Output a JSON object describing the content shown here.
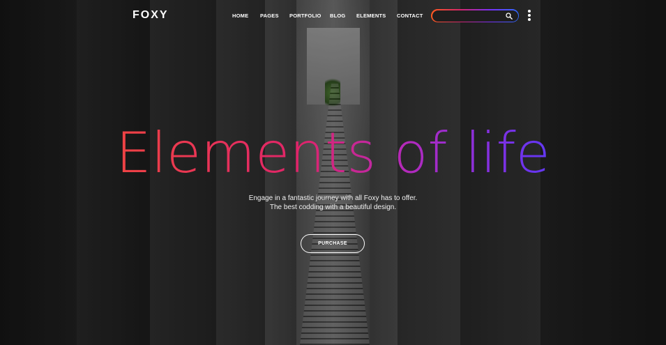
{
  "brand": {
    "logo_text": "FOXY"
  },
  "nav": {
    "items": [
      {
        "label": "HOME"
      },
      {
        "label": "PAGES"
      },
      {
        "label": "PORTFOLIO"
      },
      {
        "label": "BLOG"
      },
      {
        "label": "ELEMENTS"
      },
      {
        "label": "CONTACT"
      }
    ]
  },
  "search": {
    "placeholder": "",
    "value": "",
    "icon": "search-icon"
  },
  "menu": {
    "icon": "vertical-dots-icon"
  },
  "hero": {
    "headline": "Elements of life",
    "subtitle_line1": "Engage in a fantastic journey with all Foxy has to offer.",
    "subtitle_line2": "The best codding with a beautiful design.",
    "cta_label": "PURCHASE"
  },
  "colors": {
    "gradient_start": "#f2552a",
    "gradient_mid": "#e0246a",
    "gradient_purple": "#6a34f0",
    "gradient_end": "#2b63f2"
  }
}
